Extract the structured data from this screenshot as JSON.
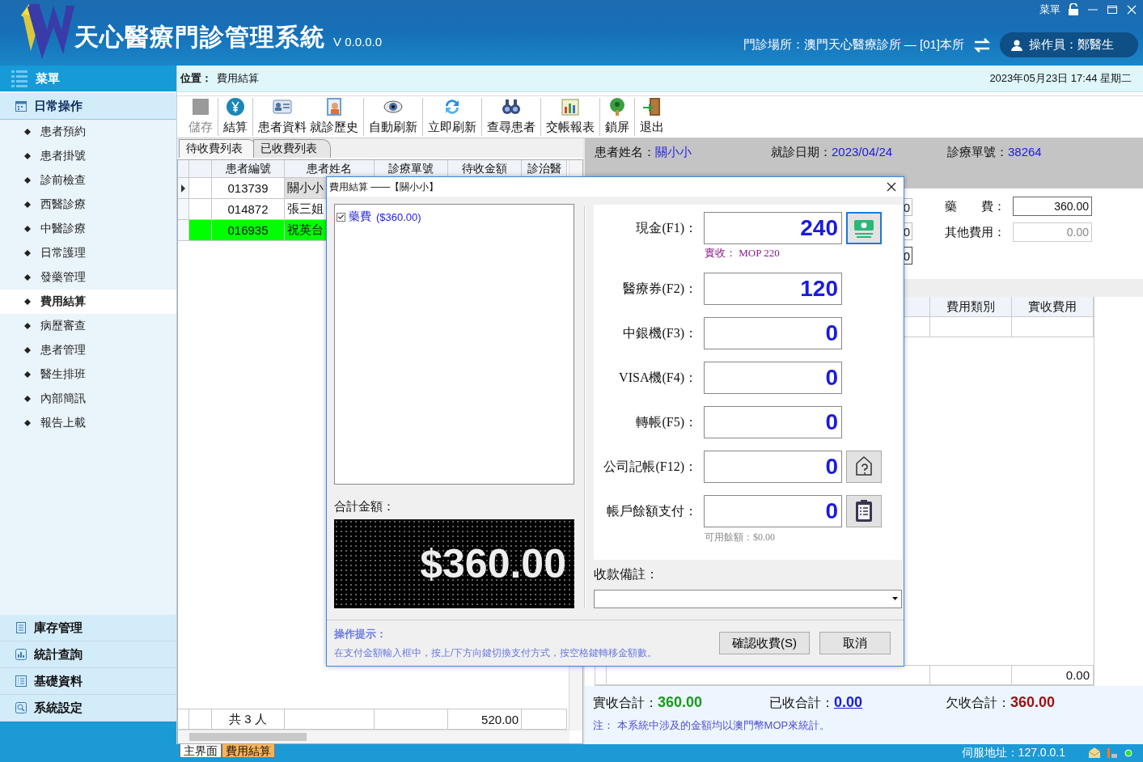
{
  "header": {
    "title": "天心醫療門診管理系統",
    "version": "V 0.0.0.0",
    "menu_label": "菜單",
    "clinic": "門診場所：澳門天心醫療診所 — [01]本所",
    "operator": "操作員：鄭醫生"
  },
  "sidebar": {
    "title": "菜單",
    "groups": [
      {
        "label": "日常操作",
        "expanded": true,
        "items": [
          {
            "label": "患者預約",
            "selected": false
          },
          {
            "label": "患者掛號",
            "selected": false
          },
          {
            "label": "診前檢查",
            "selected": false
          },
          {
            "label": "西醫診療",
            "selected": false
          },
          {
            "label": "中醫診療",
            "selected": false
          },
          {
            "label": "日常護理",
            "selected": false
          },
          {
            "label": "發藥管理",
            "selected": false
          },
          {
            "label": "費用結算",
            "selected": true
          },
          {
            "label": "病歷審查",
            "selected": false
          },
          {
            "label": "患者管理",
            "selected": false
          },
          {
            "label": "醫生排班",
            "selected": false
          },
          {
            "label": "內部簡訊",
            "selected": false
          },
          {
            "label": "報告上載",
            "selected": false
          }
        ]
      },
      {
        "label": "庫存管理",
        "expanded": false
      },
      {
        "label": "統計查詢",
        "expanded": false
      },
      {
        "label": "基礎資料",
        "expanded": false
      },
      {
        "label": "系統設定",
        "expanded": false
      }
    ]
  },
  "location": {
    "label": "位置：",
    "value": "費用結算",
    "datetime": "2023年05月23日 17:44  星期二"
  },
  "toolbar": [
    [
      {
        "label": "儲存",
        "disabled": true
      }
    ],
    [
      {
        "label": "結算",
        "disabled": false
      }
    ],
    [
      {
        "label": "患者資料",
        "disabled": false
      },
      {
        "label": "就診歷史",
        "disabled": false
      }
    ],
    [
      {
        "label": "自動刷新",
        "disabled": false
      }
    ],
    [
      {
        "label": "立即刷新",
        "disabled": false
      }
    ],
    [
      {
        "label": "查尋患者",
        "disabled": false
      }
    ],
    [
      {
        "label": "交帳報表",
        "disabled": false
      }
    ],
    [
      {
        "label": "鎖屏",
        "disabled": false
      }
    ],
    [
      {
        "label": "退出",
        "disabled": false
      }
    ]
  ],
  "list_tabs": [
    {
      "label": "待收費列表",
      "selected": true
    },
    {
      "label": "已收費列表",
      "selected": false
    }
  ],
  "grid": {
    "columns": [
      "患者編號",
      "患者姓名",
      "診療單號",
      "待收金額",
      "診治醫"
    ],
    "rows": [
      {
        "id": "013739",
        "name": "關小小",
        "current": true,
        "highlighted": false
      },
      {
        "id": "014872",
        "name": "張三姐",
        "current": false,
        "highlighted": false
      },
      {
        "id": "016935",
        "name": "祝英台",
        "current": false,
        "highlighted": true
      }
    ],
    "footer_count": "共 3 人",
    "footer_total": "520.00"
  },
  "info": [
    {
      "label": "患者姓名：",
      "value": "關小小"
    },
    {
      "label": "就診日期：",
      "value": "2023/04/24"
    },
    {
      "label": "診療單號：",
      "value": "38264"
    }
  ],
  "partial_fields": [
    {
      "value": "0",
      "focused": false
    },
    {
      "value": "0",
      "focused": false
    },
    {
      "value": "0",
      "focused": true
    }
  ],
  "fee_fields": [
    {
      "label": "藥　　費：",
      "value": "360.00",
      "disabled": false
    },
    {
      "label": "其他費用：",
      "value": "0.00",
      "disabled": true
    }
  ],
  "fee_table": {
    "columns": [
      "費用類別",
      "實收費用"
    ],
    "footer_total": "0.00"
  },
  "totals": [
    {
      "label": "實收合計：",
      "value": "360.00",
      "kind": "paid"
    },
    {
      "label": "已收合計：",
      "value": "0.00",
      "kind": "link"
    },
    {
      "label": "欠收合計：",
      "value": "360.00",
      "kind": "owed"
    }
  ],
  "note": "注： 本系統中涉及的金額均以澳門幣MOP來統計。",
  "dialog": {
    "title": "費用結算 ——【關小小】",
    "items": [
      {
        "label": "藥費",
        "amount": "($360.00)",
        "checked": true
      }
    ],
    "total_label": "合計金額：",
    "total": "$360.00",
    "payments": [
      {
        "kind": "normal",
        "label": "現金(F1)：",
        "value": "240",
        "focused": true,
        "note": "實收： MOP 220"
      },
      {
        "kind": "normal",
        "label": "醫療券(F2)：",
        "value": "120"
      },
      {
        "kind": "normal",
        "label": "中銀機(F3)：",
        "value": "0"
      },
      {
        "kind": "normal",
        "label": "VISA機(F4)：",
        "value": "0"
      },
      {
        "kind": "normal",
        "label": "轉帳(F5)：",
        "value": "0"
      },
      {
        "kind": "normal",
        "label": "公司記帳(F12)：",
        "value": "0",
        "focused": false
      },
      {
        "kind": "account",
        "label": "帳戶餘額支付：",
        "value": "0",
        "focused": false,
        "hint": "可用餘額：$0.00"
      }
    ],
    "remark_label": "收款備註：",
    "tip_title": "操作提示：",
    "tip": "在支付金額輸入框中，按上/下方向鍵切換支付方式，按空格鍵轉移金額數。",
    "buttons": [
      {
        "label": "確認收費(S)",
        "kind": "primary"
      },
      {
        "label": "取消",
        "kind": "cancel"
      }
    ]
  },
  "status_bar": {
    "tabs": [
      {
        "label": "主界面",
        "selected": false
      },
      {
        "label": "費用結算",
        "selected": true
      }
    ],
    "server": "伺服地址：127.0.0.1"
  }
}
